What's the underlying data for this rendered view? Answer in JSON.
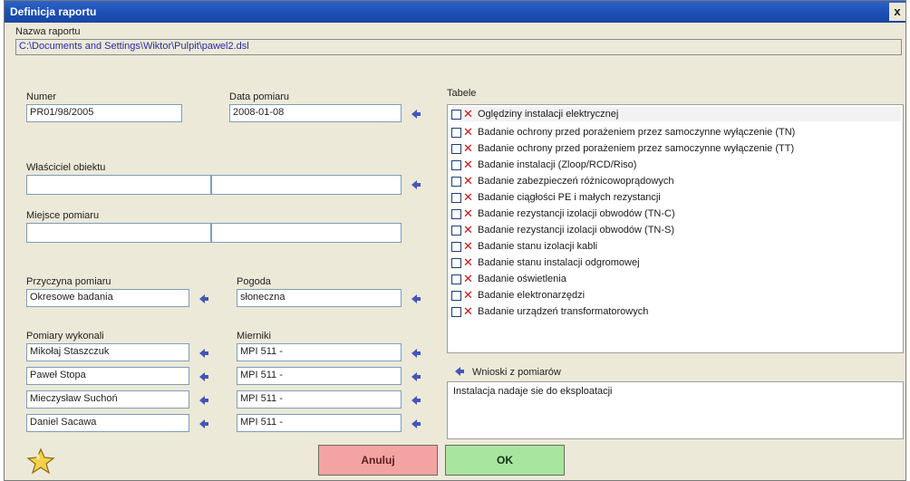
{
  "window": {
    "title": "Definicja raportu",
    "close": "x"
  },
  "report": {
    "name_label": "Nazwa raportu",
    "name_value": "C:\\Documents and Settings\\Wiktor\\Pulpit\\pawel2.dsl"
  },
  "number": {
    "label": "Numer",
    "value": "PR01/98/2005"
  },
  "date": {
    "label": "Data pomiaru",
    "value": "2008-01-08"
  },
  "owner": {
    "label": "Właściciel obiektu",
    "value1": "",
    "value2": ""
  },
  "place": {
    "label": "Miejsce pomiaru",
    "value1": "",
    "value2": ""
  },
  "reason": {
    "label": "Przyczyna pomiaru",
    "value": "Okresowe badania"
  },
  "weather": {
    "label": "Pogoda",
    "value": "słoneczna"
  },
  "performers": {
    "label": "Pomiary wykonali",
    "items": [
      "Mikołaj Staszczuk",
      "Paweł Stopa",
      "Mieczysław Suchoń",
      "Daniel Sacawa"
    ]
  },
  "meters": {
    "label": "Mierniki",
    "items": [
      "MPI 511 -",
      "MPI 511 -",
      "MPI 511 -",
      "MPI 511 -"
    ]
  },
  "tables": {
    "label": "Tabele",
    "items": [
      "Oględziny instalacji elektrycznej",
      "Badanie ochrony przed porażeniem przez samoczynne wyłączenie (TN)",
      "Badanie ochrony przed porażeniem przez samoczynne wyłączenie (TT)",
      "Badanie instalacji (Zloop/RCD/Riso)",
      "Badanie zabezpieczeń różnicowoprądowych",
      "Badanie ciągłości PE i małych rezystancji",
      "Badanie rezystancji izolacji obwodów (TN-C)",
      "Badanie rezystancji izolacji obwodów (TN-S)",
      "Badanie stanu izolacji kabli",
      "Badanie stanu instalacji odgromowej",
      "Badanie oświetlenia",
      "Badanie elektronarzędzi",
      "Badanie urządzeń transformatorowych"
    ]
  },
  "conclusions": {
    "label": "Wnioski z pomiarów",
    "value": "Instalacja nadaje sie do eksploatacji"
  },
  "buttons": {
    "cancel": "Anuluj",
    "ok": "OK"
  },
  "colors": {
    "cancel_bg": "#f4a3a3",
    "ok_bg": "#a8e6a0",
    "title_bar": "#1c4fb3"
  }
}
